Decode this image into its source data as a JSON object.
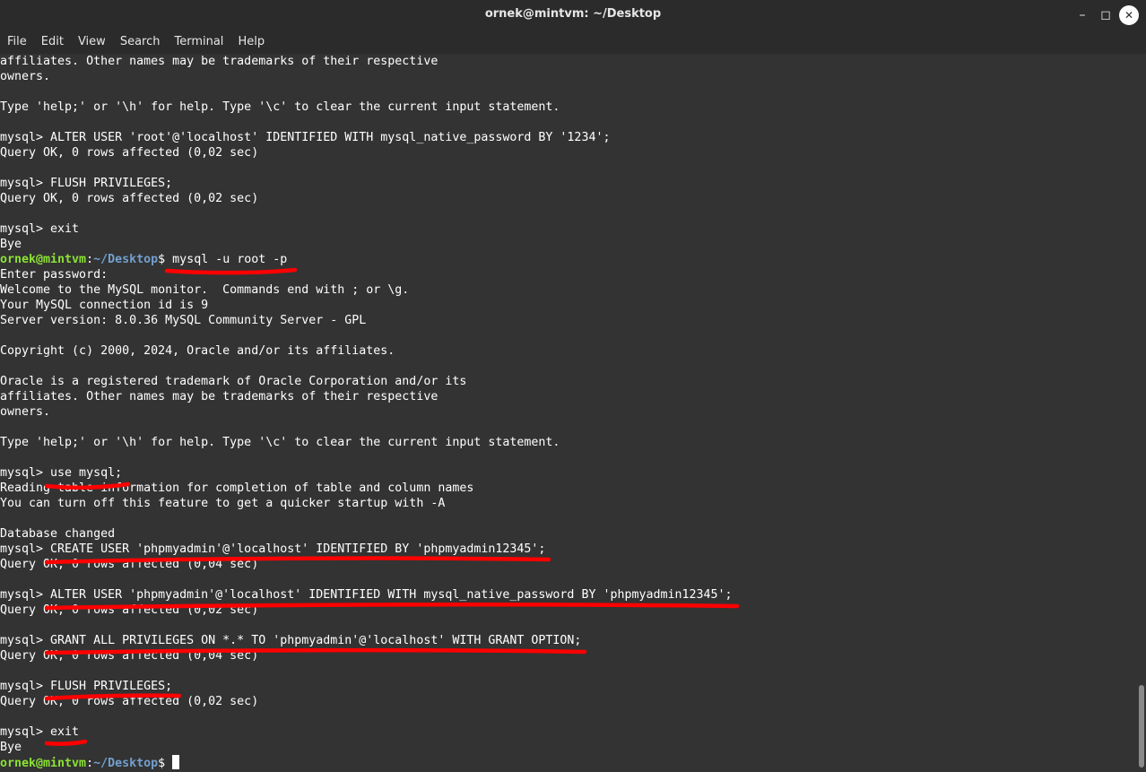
{
  "window": {
    "title": "ornek@mintvm: ~/Desktop",
    "minimize_label": "–",
    "maximize_label": "◻",
    "close_label": "✕"
  },
  "menu": [
    "File",
    "Edit",
    "View",
    "Search",
    "Terminal",
    "Help"
  ],
  "colors": {
    "background": "#333333",
    "titlebar": "#2b2b2b",
    "text": "#ffffff",
    "prompt_user": "#8ae234",
    "prompt_path": "#729fcf",
    "annotation": "#ff0000"
  },
  "terminal": {
    "lines": [
      "affiliates. Other names may be trademarks of their respective",
      "owners.",
      "",
      "Type 'help;' or '\\h' for help. Type '\\c' to clear the current input statement.",
      "",
      "mysql> ALTER USER 'root'@'localhost' IDENTIFIED WITH mysql_native_password BY '1234';",
      "Query OK, 0 rows affected (0,02 sec)",
      "",
      "mysql> FLUSH PRIVILEGES;",
      "Query OK, 0 rows affected (0,02 sec)",
      "",
      "mysql> exit",
      "Bye",
      {
        "user": "ornek@mintvm",
        "sep": ":",
        "path": "~/Desktop",
        "dollar": "$ ",
        "cmd": "mysql -u root -p"
      },
      "Enter password:",
      "Welcome to the MySQL monitor.  Commands end with ; or \\g.",
      "Your MySQL connection id is 9",
      "Server version: 8.0.36 MySQL Community Server - GPL",
      "",
      "Copyright (c) 2000, 2024, Oracle and/or its affiliates.",
      "",
      "Oracle is a registered trademark of Oracle Corporation and/or its",
      "affiliates. Other names may be trademarks of their respective",
      "owners.",
      "",
      "Type 'help;' or '\\h' for help. Type '\\c' to clear the current input statement.",
      "",
      "mysql> use mysql;",
      "Reading table information for completion of table and column names",
      "You can turn off this feature to get a quicker startup with -A",
      "",
      "Database changed",
      "mysql> CREATE USER 'phpmyadmin'@'localhost' IDENTIFIED BY 'phpmyadmin12345';",
      "Query OK, 0 rows affected (0,04 sec)",
      "",
      "mysql> ALTER USER 'phpmyadmin'@'localhost' IDENTIFIED WITH mysql_native_password BY 'phpmyadmin12345';",
      "Query OK, 0 rows affected (0,02 sec)",
      "",
      "mysql> GRANT ALL PRIVILEGES ON *.* TO 'phpmyadmin'@'localhost' WITH GRANT OPTION;",
      "Query OK, 0 rows affected (0,04 sec)",
      "",
      "mysql> FLUSH PRIVILEGES;",
      "Query OK, 0 rows affected (0,02 sec)",
      "",
      "mysql> exit",
      "Bye",
      {
        "user": "ornek@mintvm",
        "sep": ":",
        "path": "~/Desktop",
        "dollar": "$ ",
        "cmd": "",
        "cursor": true
      }
    ]
  }
}
